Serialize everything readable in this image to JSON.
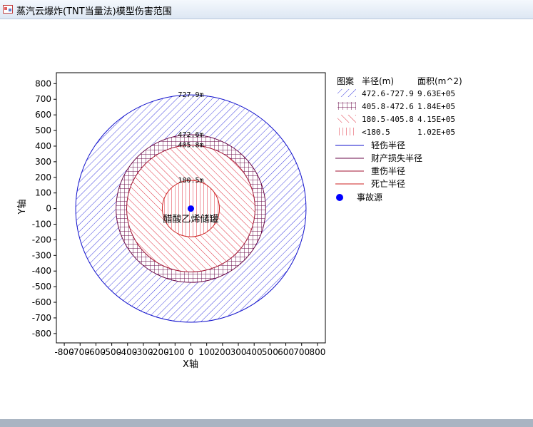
{
  "window": {
    "title": "蒸汽云爆炸(TNT当量法)模型伤害范围"
  },
  "chart_data": {
    "type": "scatter",
    "xlabel": "X轴",
    "ylabel": "Y轴",
    "xlim": [
      -850,
      850
    ],
    "ylim": [
      -860,
      870
    ],
    "xticks": [
      -800,
      -700,
      -600,
      -500,
      -400,
      -300,
      -200,
      -100,
      0,
      100,
      200,
      300,
      400,
      500,
      600,
      700,
      800
    ],
    "xtick_labels": [
      "-800",
      "-700",
      "-600",
      "-500",
      "-400",
      "-300",
      "-200",
      "-100",
      "0",
      "100",
      "200",
      "300",
      "400",
      "500",
      "600",
      "700",
      "800"
    ],
    "yticks": [
      800,
      700,
      600,
      500,
      400,
      300,
      200,
      100,
      0,
      -100,
      -200,
      -300,
      -400,
      -500,
      -600,
      -700,
      -800
    ],
    "ytick_labels": [
      "800",
      "700",
      "600",
      "500",
      "400",
      "300",
      "200",
      "100",
      "0",
      "-100",
      "-200",
      "-300",
      "-400",
      "-500",
      "-600",
      "-700",
      "-800"
    ],
    "grid": false,
    "legend_position": "right",
    "circles": [
      {
        "radius": 727.9,
        "label": "727.9m",
        "color": "#1010cc",
        "pattern": "diag-blue"
      },
      {
        "radius": 472.6,
        "label": "472.6m",
        "color": "#6a0a4a",
        "pattern": "grid-purple"
      },
      {
        "radius": 405.8,
        "label": "405.8m",
        "color": "#a01030",
        "pattern": "diag-red"
      },
      {
        "radius": 180.5,
        "label": "180.5m",
        "color": "#cc2020",
        "pattern": "vert-red"
      }
    ],
    "source": {
      "x": 0,
      "y": 0,
      "label": "醋酸乙烯储罐",
      "color": "#0000ff"
    }
  },
  "legend": {
    "header": {
      "pattern": "图案",
      "radius": "半径(m)",
      "area": "面积(m^2)"
    },
    "patterns": [
      {
        "range": "472.6-727.9",
        "area": "9.63E+05",
        "pattern": "diag-blue"
      },
      {
        "range": "405.8-472.6",
        "area": "1.84E+05",
        "pattern": "grid-purple"
      },
      {
        "range": "180.5-405.8",
        "area": "4.15E+05",
        "pattern": "diag-red"
      },
      {
        "range": "<180.5",
        "area": "1.02E+05",
        "pattern": "vert-red"
      }
    ],
    "lines": [
      {
        "label": "轻伤半径",
        "color": "#1010cc"
      },
      {
        "label": "财产损失半径",
        "color": "#6a0a4a"
      },
      {
        "label": "重伤半径",
        "color": "#a01030"
      },
      {
        "label": "死亡半径",
        "color": "#cc2020"
      }
    ],
    "marker": {
      "label": "事故源",
      "color": "#0000ff"
    }
  }
}
